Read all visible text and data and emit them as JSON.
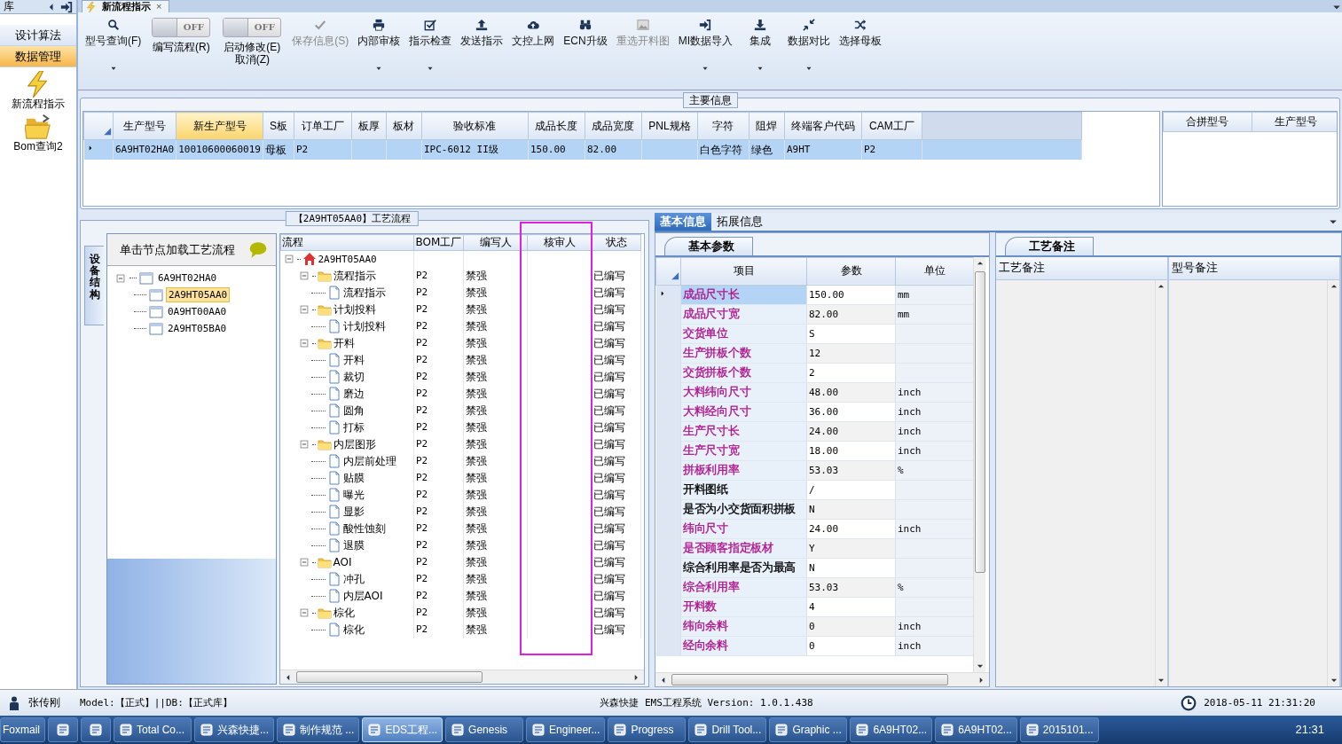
{
  "sidebar": {
    "title": "库",
    "items": [
      {
        "label": "设计算法",
        "selected": false
      },
      {
        "label": "数据管理",
        "selected": true
      }
    ],
    "shortcuts": [
      {
        "label": "新流程指示"
      },
      {
        "label": "Bom查询2"
      }
    ]
  },
  "document_tab": {
    "label": "新流程指示",
    "close": "×",
    "selected": true
  },
  "toolbar": [
    {
      "kind": "button",
      "label": "型号查询(F)",
      "disabled": false,
      "dropdown": true
    },
    {
      "kind": "toggle",
      "switch_text": "OFF",
      "on": false,
      "label": "编写流程(R)"
    },
    {
      "kind": "toggle",
      "switch_text": "OFF",
      "on": false,
      "label": "启动修改(E)",
      "sublabel": "取消(Z)"
    },
    {
      "kind": "button",
      "label": "保存信息(S)",
      "disabled": true,
      "dropdown": false
    },
    {
      "kind": "button",
      "label": "内部审核",
      "disabled": false,
      "dropdown": true
    },
    {
      "kind": "button",
      "label": "指示检查",
      "disabled": false,
      "dropdown": true
    },
    {
      "kind": "button",
      "label": "发送指示",
      "disabled": false,
      "dropdown": false
    },
    {
      "kind": "button",
      "label": "文控上网",
      "disabled": false,
      "dropdown": false
    },
    {
      "kind": "button",
      "label": "ECN升级",
      "disabled": false,
      "dropdown": false
    },
    {
      "kind": "button",
      "label": "重选开料图",
      "disabled": true,
      "dropdown": false
    },
    {
      "kind": "button",
      "label": "MI数据导入",
      "disabled": false,
      "dropdown": true
    },
    {
      "kind": "button",
      "label": "集成",
      "disabled": false,
      "dropdown": true
    },
    {
      "kind": "button",
      "label": "数据对比",
      "disabled": false,
      "dropdown": true
    },
    {
      "kind": "button",
      "label": "选择母板",
      "disabled": false,
      "dropdown": false
    }
  ],
  "main_info": {
    "title": "主要信息",
    "columns": [
      {
        "label": "生产型号",
        "selected": false
      },
      {
        "label": "新生产型号",
        "selected": true
      },
      {
        "label": "S板",
        "selected": false
      },
      {
        "label": "订单工厂",
        "selected": false
      },
      {
        "label": "板厚",
        "selected": false
      },
      {
        "label": "板材",
        "selected": false
      },
      {
        "label": "验收标准",
        "selected": false
      },
      {
        "label": "成品长度",
        "selected": false
      },
      {
        "label": "成品宽度",
        "selected": false
      },
      {
        "label": "PNL规格",
        "selected": false
      },
      {
        "label": "字符",
        "selected": false
      },
      {
        "label": "阻焊",
        "selected": false
      },
      {
        "label": "终端客户代码",
        "selected": false
      },
      {
        "label": "CAM工厂",
        "selected": false
      }
    ],
    "rows": [
      {
        "selected": true,
        "cells": [
          "6A9HT02HA0",
          "10010600060019",
          "母板",
          "P2",
          null,
          null,
          "IPC-6012 II级",
          "150.00",
          "82.00",
          null,
          "白色字符",
          "绿色",
          "A9HT",
          "P2"
        ]
      }
    ],
    "merge_columns": [
      "合拼型号",
      "生产型号"
    ]
  },
  "flow_panel": {
    "title": "【2A9HT05AA0】工艺流程",
    "side_tab": "设备结构",
    "tree_header": "单击节点加载工艺流程",
    "model_tree": [
      {
        "label": "6A9HT02HA0",
        "expanded": true,
        "selected": false,
        "children": [
          {
            "label": "2A9HT05AA0",
            "selected": true
          },
          {
            "label": "0A9HT00AA0",
            "selected": false
          },
          {
            "label": "2A9HT05BA0",
            "selected": false
          }
        ]
      }
    ],
    "columns": [
      "流程",
      "BOM工厂",
      "编写人",
      "核审人",
      "状态"
    ],
    "process_tree": [
      {
        "kind": "root",
        "label": "2A9HT05AA0",
        "expanded": true,
        "children": [
          {
            "kind": "folder",
            "label": "流程指示",
            "bom_factory": "P2",
            "writer": "禁强",
            "status": "已编写",
            "expanded": true,
            "children": [
              {
                "kind": "step",
                "label": "流程指示",
                "bom_factory": "P2",
                "writer": "禁强",
                "status": "已编写"
              }
            ]
          },
          {
            "kind": "folder",
            "label": "计划投料",
            "bom_factory": "P2",
            "writer": "禁强",
            "status": "已编写",
            "expanded": true,
            "children": [
              {
                "kind": "step",
                "label": "计划投料",
                "bom_factory": "P2",
                "writer": "禁强",
                "status": "已编写"
              }
            ]
          },
          {
            "kind": "folder",
            "label": "开料",
            "bom_factory": "P2",
            "writer": "禁强",
            "status": "已编写",
            "expanded": true,
            "children": [
              {
                "kind": "step",
                "label": "开料",
                "bom_factory": "P2",
                "writer": "禁强",
                "status": "已编写"
              },
              {
                "kind": "step",
                "label": "裁切",
                "bom_factory": "P2",
                "writer": "禁强",
                "status": "已编写"
              },
              {
                "kind": "step",
                "label": "磨边",
                "bom_factory": "P2",
                "writer": "禁强",
                "status": "已编写"
              },
              {
                "kind": "step",
                "label": "圆角",
                "bom_factory": "P2",
                "writer": "禁强",
                "status": "已编写"
              },
              {
                "kind": "step",
                "label": "打标",
                "bom_factory": "P2",
                "writer": "禁强",
                "status": "已编写"
              }
            ]
          },
          {
            "kind": "folder",
            "label": "内层图形",
            "bom_factory": "P2",
            "writer": "禁强",
            "status": "已编写",
            "expanded": true,
            "children": [
              {
                "kind": "step",
                "label": "内层前处理",
                "bom_factory": "P2",
                "writer": "禁强",
                "status": "已编写"
              },
              {
                "kind": "step",
                "label": "贴膜",
                "bom_factory": "P2",
                "writer": "禁强",
                "status": "已编写"
              },
              {
                "kind": "step",
                "label": "曝光",
                "bom_factory": "P2",
                "writer": "禁强",
                "status": "已编写"
              },
              {
                "kind": "step",
                "label": "显影",
                "bom_factory": "P2",
                "writer": "禁强",
                "status": "已编写"
              },
              {
                "kind": "step",
                "label": "酸性蚀刻",
                "bom_factory": "P2",
                "writer": "禁强",
                "status": "已编写"
              },
              {
                "kind": "step",
                "label": "退膜",
                "bom_factory": "P2",
                "writer": "禁强",
                "status": "已编写"
              }
            ]
          },
          {
            "kind": "folder",
            "label": "AOI",
            "bom_factory": "P2",
            "writer": "禁强",
            "status": "已编写",
            "expanded": true,
            "children": [
              {
                "kind": "step",
                "label": "冲孔",
                "bom_factory": "P2",
                "writer": "禁强",
                "status": "已编写"
              },
              {
                "kind": "step",
                "label": "内层AOI",
                "bom_factory": "P2",
                "writer": "禁强",
                "status": "已编写"
              }
            ]
          },
          {
            "kind": "folder",
            "label": "棕化",
            "bom_factory": "P2",
            "writer": "禁强",
            "status": "已编写",
            "expanded": true,
            "children": [
              {
                "kind": "step",
                "label": "棕化",
                "bom_factory": "P2",
                "writer": "禁强",
                "status": "已编写"
              }
            ]
          }
        ]
      }
    ]
  },
  "detail_panel": {
    "tabs": [
      {
        "label": "基本信息",
        "selected": true
      },
      {
        "label": "拓展信息",
        "selected": false
      }
    ],
    "params_tab": "基本参数",
    "param_columns": [
      "项目",
      "参数",
      "单位"
    ],
    "params": [
      {
        "item": "成品尺寸长",
        "value": "150.00",
        "unit": "mm",
        "color": "#b0138e",
        "selected": true
      },
      {
        "item": "成品尺寸宽",
        "value": "82.00",
        "unit": "mm",
        "color": "#b0138e",
        "selected": false
      },
      {
        "item": "交货单位",
        "value": "S",
        "color": "#b0138e",
        "selected": false
      },
      {
        "item": "生产拼板个数",
        "value": "12",
        "color": "#b0138e",
        "selected": false
      },
      {
        "item": "交货拼板个数",
        "value": "2",
        "color": "#b0138e",
        "selected": false
      },
      {
        "item": "大料纬向尺寸",
        "value": "48.00",
        "unit": "inch",
        "color": "#b0138e",
        "selected": false
      },
      {
        "item": "大料经向尺寸",
        "value": "36.00",
        "unit": "inch",
        "color": "#b0138e",
        "selected": false
      },
      {
        "item": "生产尺寸长",
        "value": "24.00",
        "unit": "inch",
        "color": "#b0138e",
        "selected": false
      },
      {
        "item": "生产尺寸宽",
        "value": "18.00",
        "unit": "inch",
        "color": "#b0138e",
        "selected": false
      },
      {
        "item": "拼板利用率",
        "value": "53.03",
        "unit": "%",
        "color": "#b0138e",
        "selected": false
      },
      {
        "item": "开料图纸",
        "value": "/",
        "color": "#000000",
        "selected": false
      },
      {
        "item": "是否为小交货面积拼板",
        "value": "N",
        "color": "#000000",
        "selected": false
      },
      {
        "item": "纬向尺寸",
        "value": "24.00",
        "unit": "inch",
        "color": "#b0138e",
        "selected": false
      },
      {
        "item": "是否顾客指定板材",
        "value": "Y",
        "color": "#b0138e",
        "selected": false
      },
      {
        "item": "综合利用率是否为最高",
        "value": "N",
        "color": "#000000",
        "selected": false
      },
      {
        "item": "综合利用率",
        "value": "53.03",
        "unit": "%",
        "color": "#b0138e",
        "selected": false
      },
      {
        "item": "开料数",
        "value": "4",
        "color": "#b0138e",
        "selected": false
      },
      {
        "item": "纬向余料",
        "value": "0",
        "unit": "inch",
        "color": "#b0138e",
        "selected": false
      },
      {
        "item": "经向余料",
        "value": "0",
        "unit": "inch",
        "color": "#b0138e",
        "selected": false
      }
    ],
    "notes_tab": "工艺备注",
    "note_columns": [
      "工艺备注",
      "型号备注"
    ]
  },
  "status_bar": {
    "user": "张传刚",
    "environment": "Model:【正式】||DB:【正式库】",
    "product": "兴森快捷 EMS工程系统 Version: 1.0.1.438",
    "datetime": "2018-05-11 21:31:20"
  },
  "taskbar": {
    "items": [
      {
        "kind": "text",
        "label": "Foxmail",
        "selected": false
      },
      {
        "kind": "icon",
        "selected": false
      },
      {
        "kind": "icon",
        "selected": false
      },
      {
        "kind": "text",
        "label": "Total Co...",
        "selected": false
      },
      {
        "kind": "text",
        "label": "兴森快捷...",
        "selected": false
      },
      {
        "kind": "text",
        "label": "制作规范 ...",
        "selected": false
      },
      {
        "kind": "text",
        "label": "EDS工程...",
        "selected": true
      },
      {
        "kind": "text",
        "label": "Genesis",
        "selected": false
      },
      {
        "kind": "text",
        "label": "Engineer...",
        "selected": false
      },
      {
        "kind": "text",
        "label": "Progress",
        "selected": false
      },
      {
        "kind": "text",
        "label": "Drill Tool...",
        "selected": false
      },
      {
        "kind": "text",
        "label": "Graphic ...",
        "selected": false
      },
      {
        "kind": "text",
        "label": "6A9HT02...",
        "selected": false
      },
      {
        "kind": "text",
        "label": "6A9HT02...",
        "selected": false
      },
      {
        "kind": "text",
        "label": "2015101...",
        "selected": false
      }
    ],
    "clock": "21:31"
  }
}
